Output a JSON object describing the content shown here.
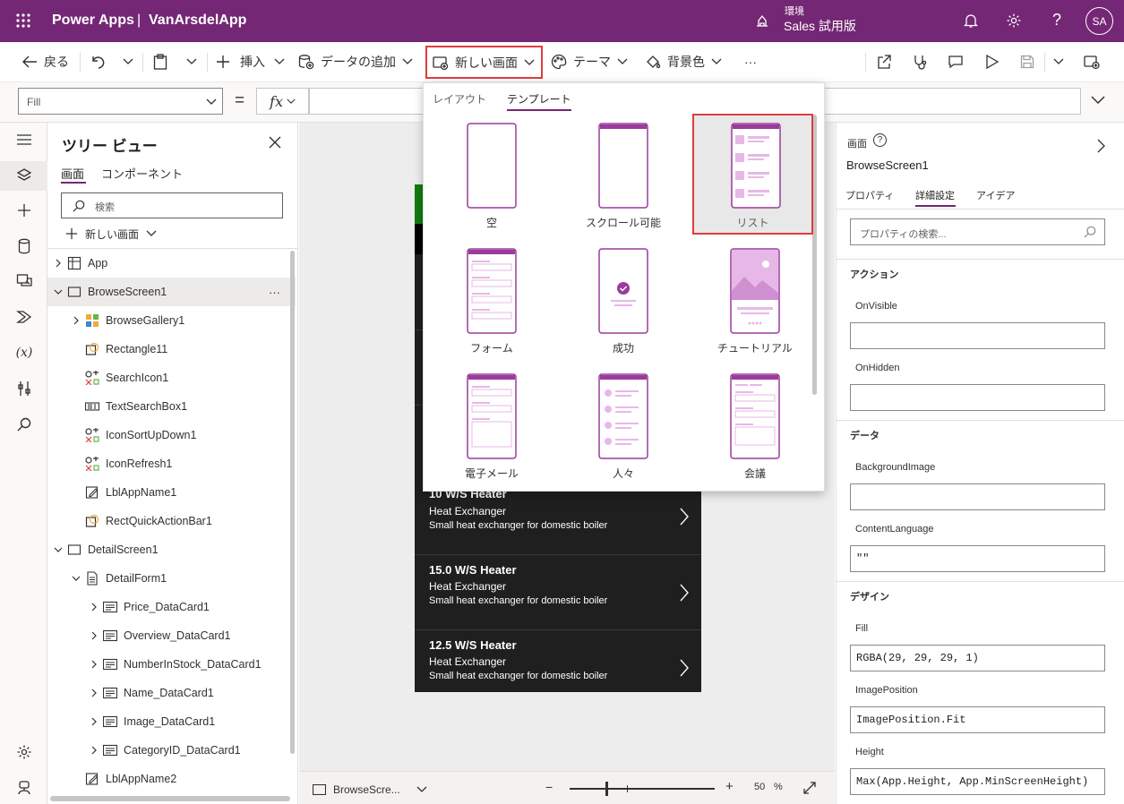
{
  "header": {
    "app_name": "Power Apps",
    "separator": "|",
    "project": "VanArsdelApp",
    "env_label": "環境",
    "env_name": "Sales 試用版",
    "avatar": "SA"
  },
  "commandbar": {
    "back": "戻る",
    "insert": "挿入",
    "add_data": "データの追加",
    "new_screen": "新しい画面",
    "theme": "テーマ",
    "background": "背景色",
    "more": "···"
  },
  "formula": {
    "property": "Fill",
    "equals": "=",
    "fx": "fx"
  },
  "tree": {
    "title": "ツリー ビュー",
    "tab_screens": "画面",
    "tab_components": "コンポーネント",
    "search_placeholder": "検索",
    "new_screen": "新しい画面",
    "more": "···",
    "items": [
      {
        "label": "App"
      },
      {
        "label": "BrowseScreen1"
      },
      {
        "label": "BrowseGallery1"
      },
      {
        "label": "Rectangle11"
      },
      {
        "label": "SearchIcon1"
      },
      {
        "label": "TextSearchBox1"
      },
      {
        "label": "IconSortUpDown1"
      },
      {
        "label": "IconRefresh1"
      },
      {
        "label": "LblAppName1"
      },
      {
        "label": "RectQuickActionBar1"
      },
      {
        "label": "DetailScreen1"
      },
      {
        "label": "DetailForm1"
      },
      {
        "label": "Price_DataCard1"
      },
      {
        "label": "Overview_DataCard1"
      },
      {
        "label": "NumberInStock_DataCard1"
      },
      {
        "label": "Name_DataCard1"
      },
      {
        "label": "Image_DataCard1"
      },
      {
        "label": "CategoryID_DataCard1"
      },
      {
        "label": "LblAppName2"
      }
    ]
  },
  "canvas": {
    "items": [
      {
        "title": "10 W/S Heater",
        "category": "Heat Exchanger",
        "desc": "Small heat exchanger for domestic boiler"
      },
      {
        "title": "15.0 W/S Heater",
        "category": "Heat Exchanger",
        "desc": "Small heat exchanger for domestic boiler"
      },
      {
        "title": "12.5 W/S Heater",
        "category": "Heat Exchanger",
        "desc": "Small heat exchanger for domestic boiler"
      }
    ]
  },
  "statusbar": {
    "screen": "BrowseScre...",
    "zoom_minus": "−",
    "zoom_plus": "+",
    "zoom_value": "50",
    "zoom_unit": "%"
  },
  "dropdown": {
    "tab_layout": "レイアウト",
    "tab_template": "テンプレート",
    "templates": [
      {
        "label": "空"
      },
      {
        "label": "スクロール可能"
      },
      {
        "label": "リスト"
      },
      {
        "label": "フォーム"
      },
      {
        "label": "成功"
      },
      {
        "label": "チュートリアル"
      },
      {
        "label": "電子メール"
      },
      {
        "label": "人々"
      },
      {
        "label": "会議"
      }
    ]
  },
  "props": {
    "type_label": "画面",
    "screen_name": "BrowseScreen1",
    "tab_properties": "プロパティ",
    "tab_advanced": "詳細設定",
    "tab_ideas": "アイデア",
    "search_placeholder": "プロパティの検索...",
    "section_action": "アクション",
    "onvisible_label": "OnVisible",
    "onvisible_value": "",
    "onhidden_label": "OnHidden",
    "onhidden_value": "",
    "section_data": "データ",
    "bgimage_label": "BackgroundImage",
    "bgimage_value": "",
    "contentlang_label": "ContentLanguage",
    "contentlang_value": "\"\"",
    "section_design": "デザイン",
    "fill_label": "Fill",
    "fill_value": "RGBA(29, 29, 29, 1)",
    "imagepos_label": "ImagePosition",
    "imagepos_value": "ImagePosition.Fit",
    "height_label": "Height",
    "height_value": "Max(App.Height, App.MinScreenHeight)"
  },
  "colors": {
    "brand": "#742774",
    "highlight": "#e03c3c",
    "template_accent": "#9b3b9b",
    "template_fill": "#e7b8e7",
    "dark_item": "#1f1f1f"
  }
}
